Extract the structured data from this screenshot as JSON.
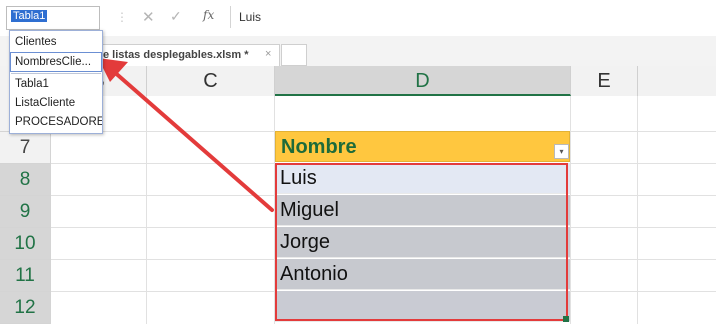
{
  "formula_bar": {
    "name_box_value": "Tabla1",
    "separator": "⋮",
    "cancel_glyph": "✕",
    "enter_glyph": "✓",
    "function_glyph": "fx",
    "formula_value": "Luis"
  },
  "document_tab": {
    "title": "e listas desplegables.xlsm *",
    "close_glyph": "×"
  },
  "column_headers": [
    "B",
    "C",
    "D",
    "E"
  ],
  "row_headers": [
    "7",
    "8",
    "9",
    "10",
    "11",
    "12"
  ],
  "table": {
    "header": "Nombre",
    "filter_glyph": "▾",
    "values": [
      "Luis",
      "Miguel",
      "Jorge",
      "Antonio",
      ""
    ]
  },
  "name_dropdown": {
    "items": [
      "Clientes",
      "NombresClie...",
      "Tabla1",
      "ListaCliente",
      "PROCESADORES"
    ]
  },
  "colors": {
    "accent_green": "#217346",
    "table_header_yellow": "#ffc73f",
    "annotation_red": "#e33b3b",
    "selection_blue": "#2f6fd1"
  }
}
